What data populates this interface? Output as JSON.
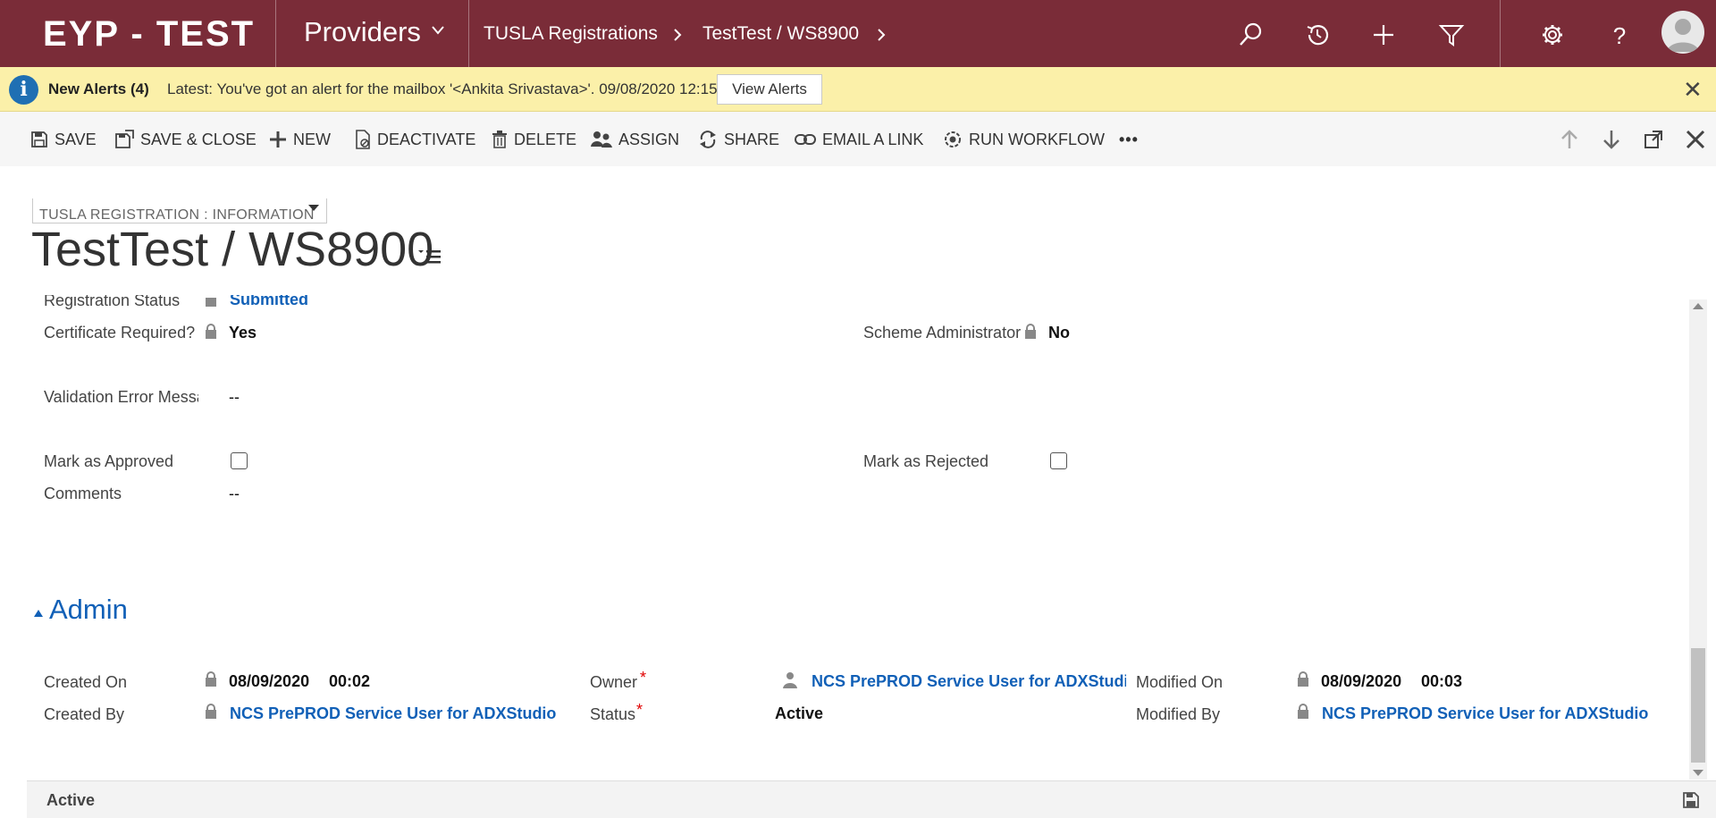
{
  "topnav": {
    "brand": "EYP - TEST",
    "area": "Providers",
    "breadcrumb": [
      "TUSLA Registrations",
      "TestTest / WS8900"
    ],
    "icons": [
      "search-icon",
      "recent-icon",
      "plus-icon",
      "filter-icon",
      "gear-icon",
      "help-icon",
      "avatar"
    ]
  },
  "alert": {
    "title": "New Alerts (4)",
    "text": "Latest: You've got an alert for the mailbox '<Ankita Srivastava>'. 09/08/2020 12:15",
    "button": "View Alerts"
  },
  "commands": {
    "save": "SAVE",
    "save_close": "SAVE & CLOSE",
    "new": "NEW",
    "deactivate": "DEACTIVATE",
    "delete": "DELETE",
    "assign": "ASSIGN",
    "share": "SHARE",
    "email_link": "EMAIL A LINK",
    "run_workflow": "RUN WORKFLOW",
    "more": "•••"
  },
  "form": {
    "selector": "TUSLA REGISTRATION : INFORMATION",
    "title": "TestTest / WS8900"
  },
  "fields": {
    "registration_status": {
      "label": "Registration Status",
      "value": "Submitted"
    },
    "certificate_required": {
      "label": "Certificate Required?",
      "value": "Yes"
    },
    "scheme_admin": {
      "label": "Scheme Administrator",
      "value": "No"
    },
    "validation_error": {
      "label": "Validation Error Message",
      "value": "--"
    },
    "mark_approved": {
      "label": "Mark as Approved",
      "checked": false
    },
    "mark_rejected": {
      "label": "Mark as Rejected",
      "checked": false
    },
    "comments": {
      "label": "Comments",
      "value": "--"
    }
  },
  "admin": {
    "section_title": "Admin",
    "created_on": {
      "label": "Created On",
      "date": "08/09/2020",
      "time": "00:02"
    },
    "created_by": {
      "label": "Created By",
      "value": "NCS PrePROD Service User for ADXStudio"
    },
    "owner": {
      "label": "Owner",
      "value": "NCS PrePROD Service User for ADXStudio"
    },
    "status": {
      "label": "Status",
      "value": "Active"
    },
    "modified_on": {
      "label": "Modified On",
      "date": "08/09/2020",
      "time": "00:03"
    },
    "modified_by": {
      "label": "Modified By",
      "value": "NCS PrePROD Service User for ADXStudio"
    },
    "required_mark": "*"
  },
  "footer": {
    "status": "Active"
  },
  "colors": {
    "nav": "#7a2c38",
    "alert": "#fbf0a9",
    "link": "#1160b7",
    "required": "#e00000"
  }
}
